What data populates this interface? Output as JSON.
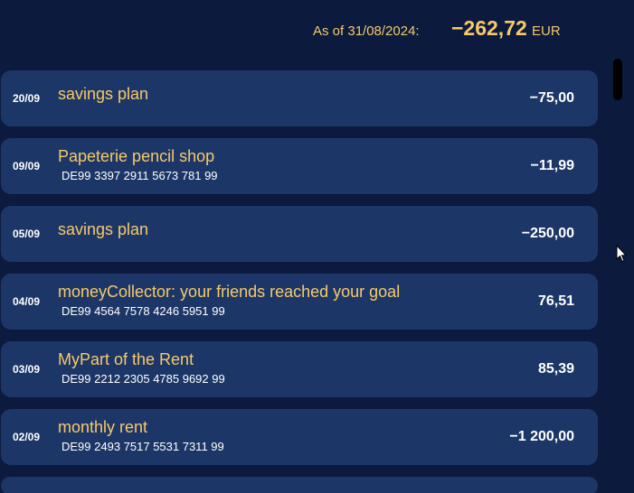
{
  "header": {
    "as_of_label": "As of 31/08/2024:",
    "balance": "−262,72",
    "currency": "EUR"
  },
  "transactions": [
    {
      "date": "20/09",
      "title": "savings plan",
      "iban": "",
      "amount": "−75,00"
    },
    {
      "date": "09/09",
      "title": "Papeterie pencil shop",
      "iban": "DE99 3397 2911 5673 781 99",
      "amount": "−11,99"
    },
    {
      "date": "05/09",
      "title": "savings plan",
      "iban": "",
      "amount": "−250,00"
    },
    {
      "date": "04/09",
      "title": "moneyCollector: your friends reached your goal",
      "iban": "DE99 4564 7578 4246 5951 99",
      "amount": "76,51"
    },
    {
      "date": "03/09",
      "title": "MyPart of the Rent",
      "iban": "DE99 2212 2305 4785 9692 99",
      "amount": "85,39"
    },
    {
      "date": "02/09",
      "title": "monthly rent",
      "iban": "DE99 2493 7517 5531 7311 99",
      "amount": "−1 200,00"
    }
  ],
  "colors": {
    "background": "#0b1a3d",
    "row_background": "#1c3767",
    "accent": "#f7c96a",
    "text": "#ffffff"
  },
  "icons": {
    "cursor": "mouse-pointer-icon"
  }
}
